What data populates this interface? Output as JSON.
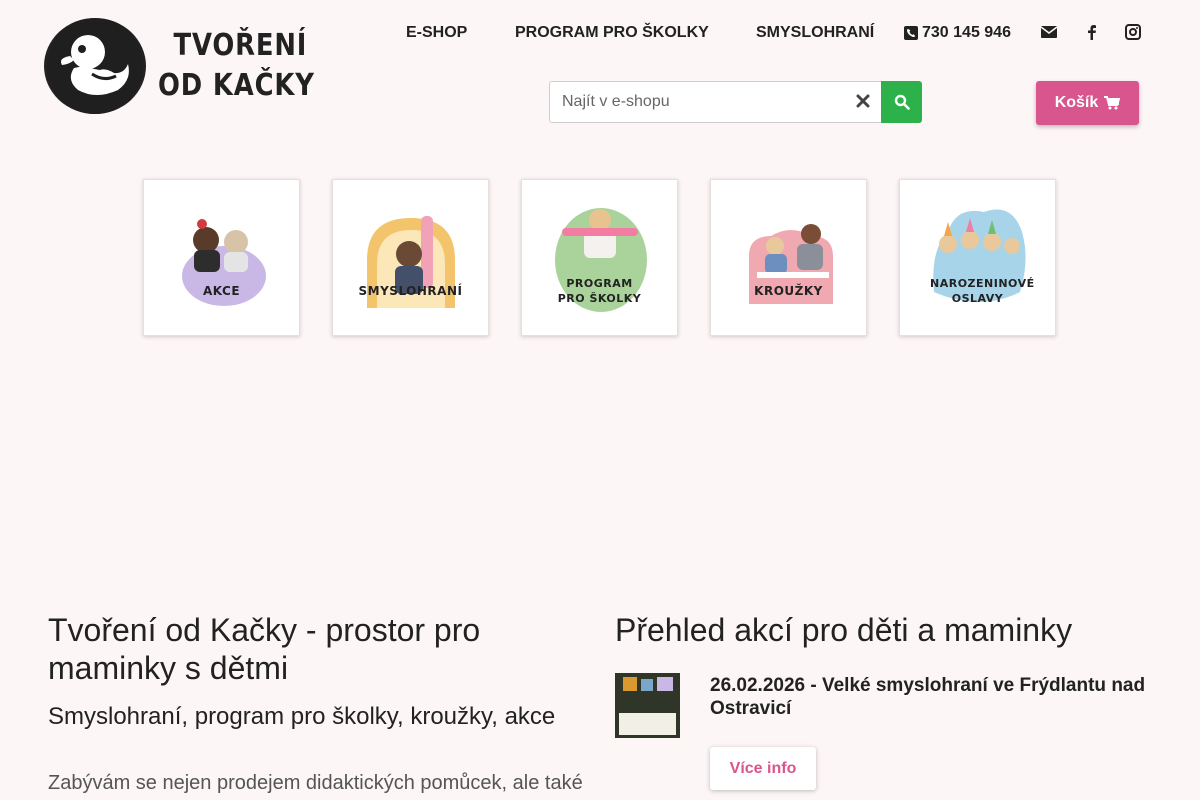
{
  "brand": {
    "line1": "TVOŘENÍ",
    "line2": "OD KAČKY"
  },
  "nav": {
    "eshop": "E-SHOP",
    "program": "PROGRAM PRO ŠKOLKY",
    "smyslohrani": "SMYSLOHRANÍ",
    "phone": "730 145 946",
    "icons": [
      "envelope-icon",
      "facebook-icon",
      "instagram-icon"
    ]
  },
  "search": {
    "placeholder": "Najít v e-shopu"
  },
  "cart": {
    "label": "Košík"
  },
  "tiles": [
    {
      "label": "AKCE",
      "color": "#c9b8e6"
    },
    {
      "label": "SMYSLOHRANÍ",
      "color": "#f3c46b"
    },
    {
      "label": "PROGRAM PRO ŠKOLKY",
      "color": "#a9d39a"
    },
    {
      "label": "KROUŽKY",
      "color": "#f0a9b1"
    },
    {
      "label": "NAROZENINOVÉ OSLAVY",
      "color": "#a8d4ea"
    }
  ],
  "intro": {
    "title": "Tvoření od Kačky - prostor pro maminky s dětmi",
    "subtitle": "Smyslohraní, program pro školky, kroužky, akce",
    "text": "Zabývám se nejen prodejem didaktických pomůcek, ale také"
  },
  "events": {
    "title": "Přehled akcí pro děti a maminky",
    "items": [
      {
        "title": "26.02.2026 - Velké smyslohraní ve Frýdlantu nad Ostravicí",
        "button": "Více info"
      }
    ]
  },
  "colors": {
    "accent": "#d9558e",
    "search_button": "#2db24b",
    "background": "#fdf6f6"
  }
}
